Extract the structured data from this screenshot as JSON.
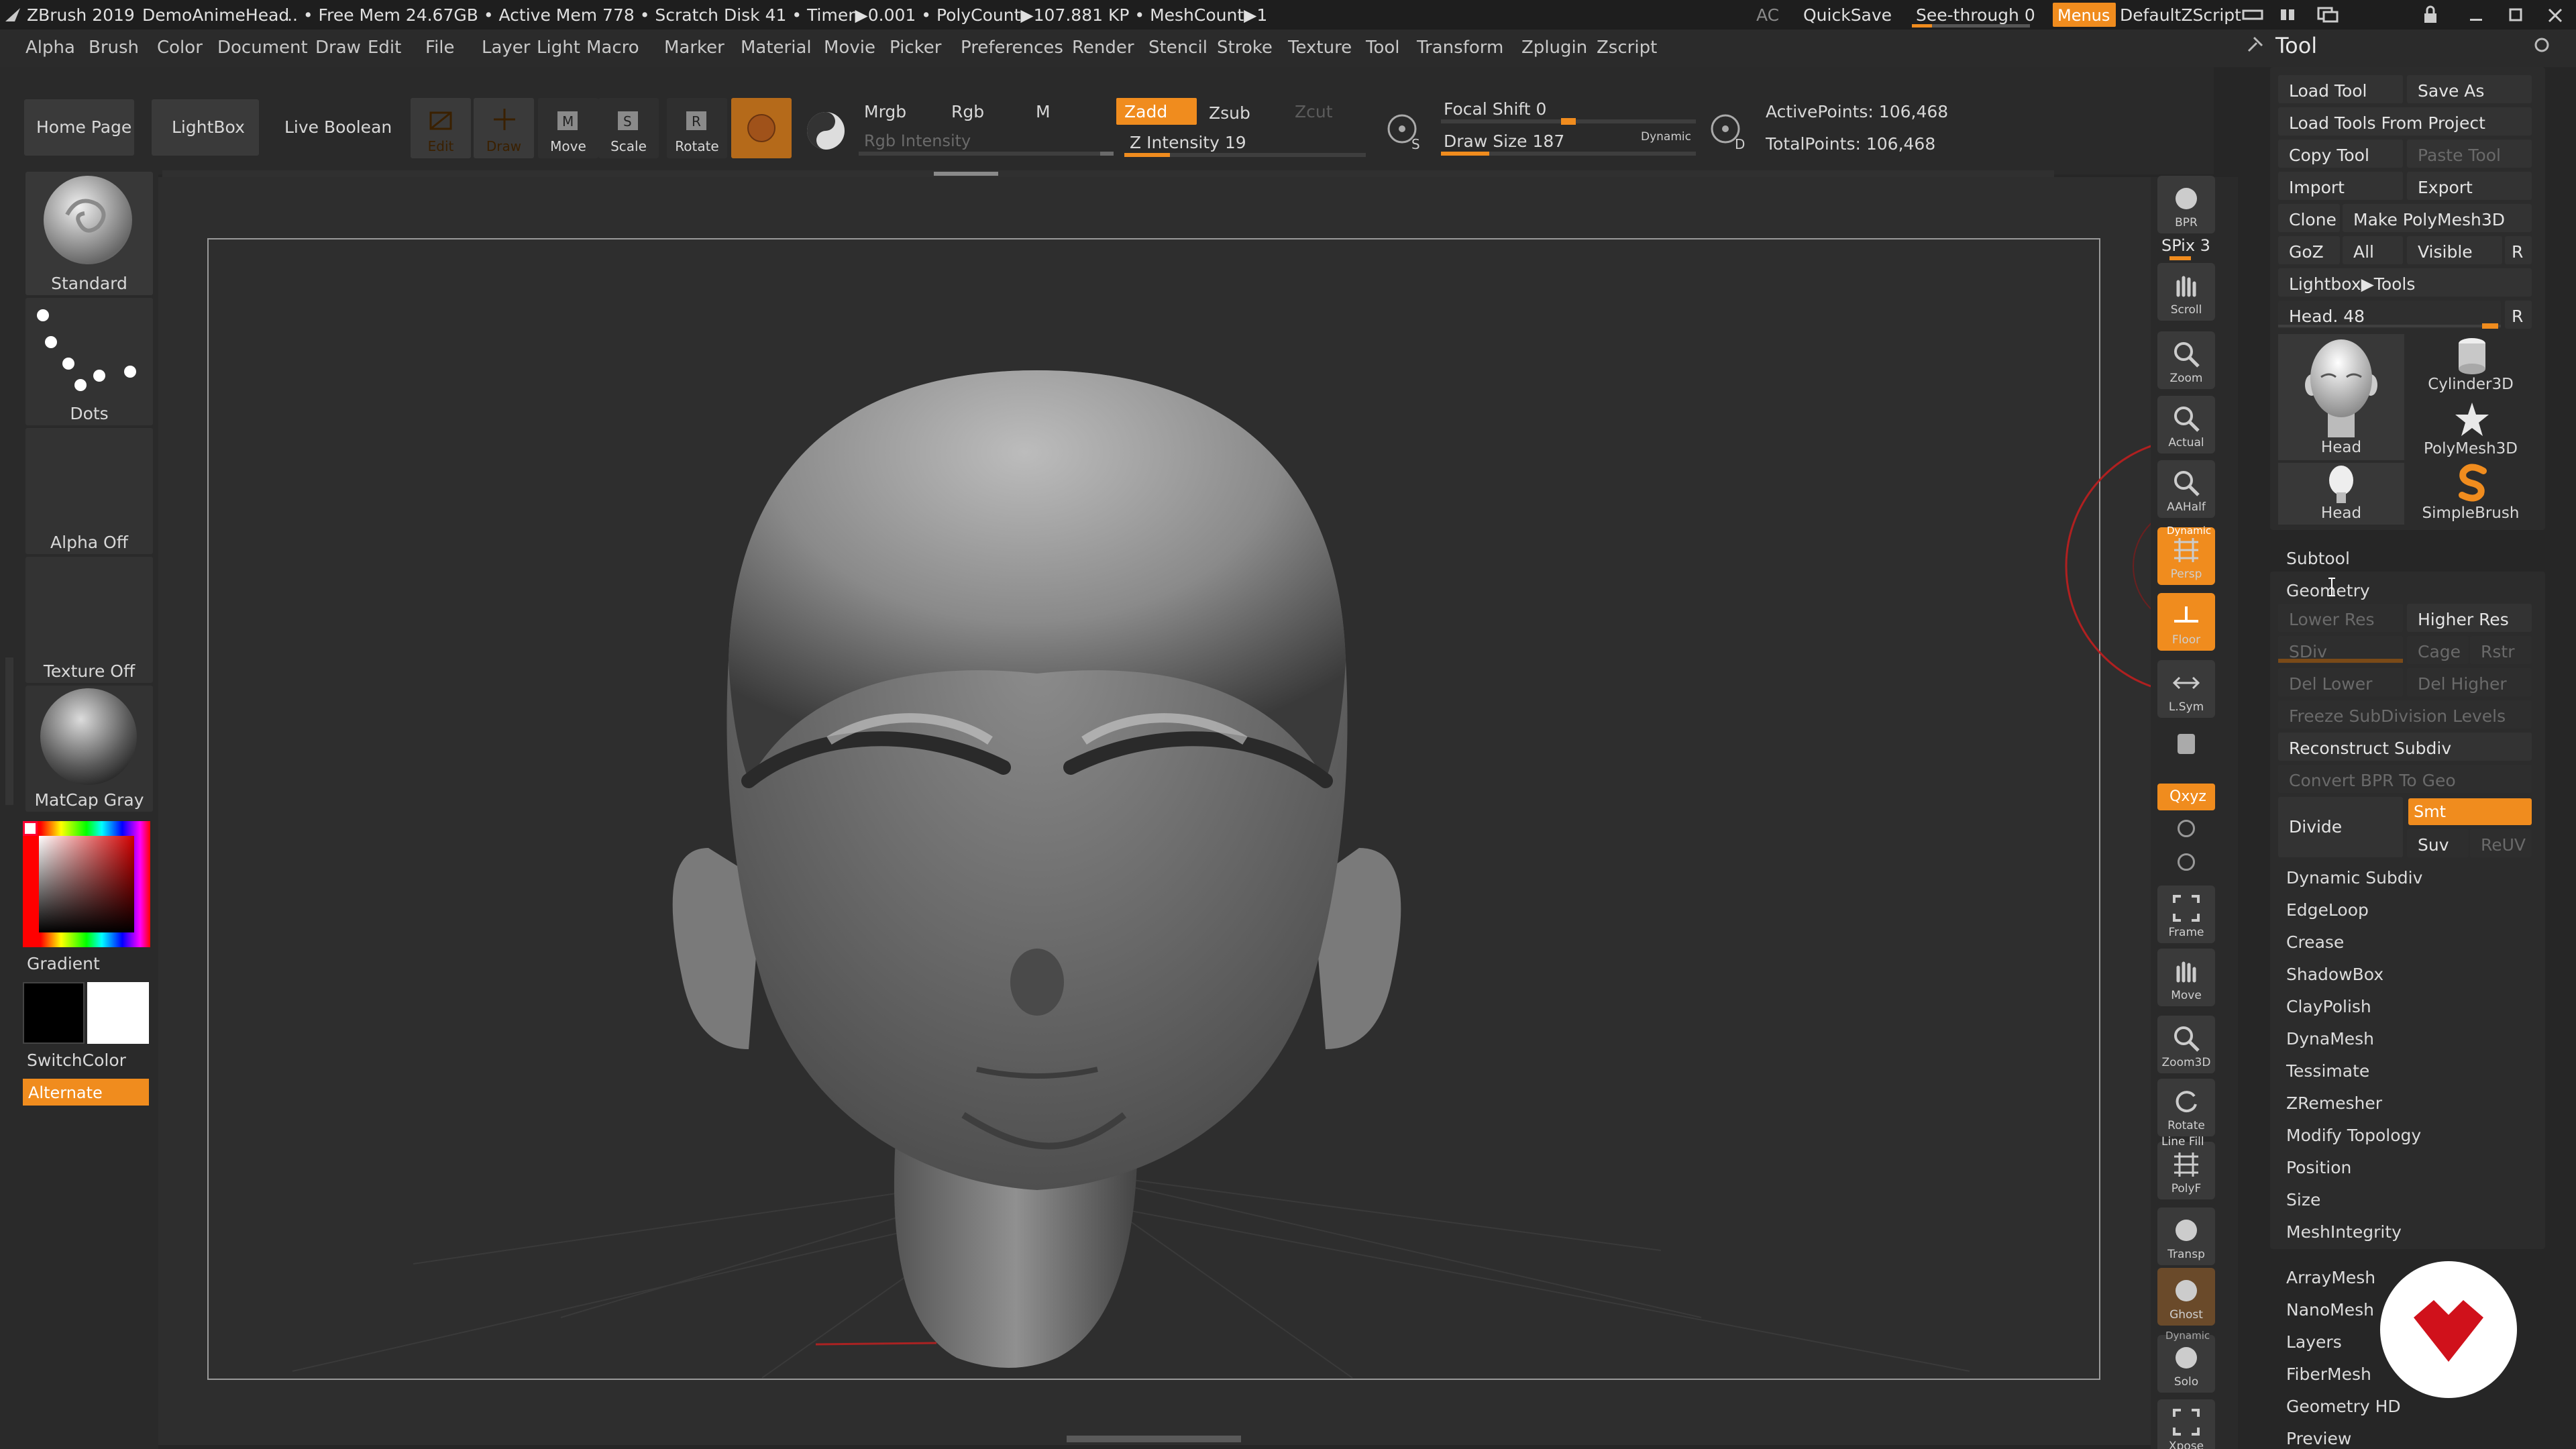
{
  "titlebar": {
    "app": "ZBrush 2019",
    "project": "DemoAnimeHead",
    "status": ".. • Free Mem 24.67GB • Active Mem 778 • Scratch Disk 41 • Timer▶0.001 • PolyCount▶107.881 KP • MeshCount▶1",
    "ac": "AC",
    "quicksave": "QuickSave",
    "seethrough": "See-through  0",
    "menus": "Menus",
    "script": "DefaultZScript"
  },
  "menubar": [
    "Alpha",
    "Brush",
    "Color",
    "Document",
    "Draw",
    "Edit",
    "File",
    "Layer",
    "Light",
    "Macro",
    "Marker",
    "Material",
    "Movie",
    "Picker",
    "Preferences",
    "Render",
    "Stencil",
    "Stroke",
    "Texture",
    "Tool",
    "Transform",
    "Zplugin",
    "Zscript"
  ],
  "toolbar": {
    "home": "Home Page",
    "lightbox": "LightBox",
    "liveboolean": "Live Boolean",
    "edit": "Edit",
    "draw": "Draw",
    "move": "Move",
    "scale": "Scale",
    "rotate": "Rotate",
    "mrgb": "Mrgb",
    "rgb": "Rgb",
    "m": "M",
    "zadd": "Zadd",
    "zsub": "Zsub",
    "zcut": "Zcut",
    "rgb_intensity": "Rgb Intensity",
    "z_intensity": "Z Intensity 19",
    "focal": "Focal Shift 0",
    "drawsize": "Draw Size 187",
    "dynamic": "Dynamic",
    "active_points": "ActivePoints: 106,468",
    "total_points": "TotalPoints: 106,468",
    "z_intensity_level": 0.19,
    "draw_size_level": 0.19,
    "focal_level": 0.5
  },
  "leftpanel": {
    "brush": "Standard",
    "stroke": "Dots",
    "alpha": "Alpha Off",
    "texture": "Texture Off",
    "material": "MatCap Gray",
    "gradient": "Gradient",
    "switchcolor": "SwitchColor",
    "alternate": "Alternate"
  },
  "rightshelf": {
    "bpr": "BPR",
    "spix": "SPix 3",
    "scroll": "Scroll",
    "zoom": "Zoom",
    "actual": "Actual",
    "aahalf": "AAHalf",
    "dynamic": "Dynamic",
    "persp": "Persp",
    "floor": "Floor",
    "lsym": "L.Sym",
    "xyz": "Qxyz",
    "frame": "Frame",
    "move": "Move",
    "zoom3d": "Zoom3D",
    "rotate": "Rotate",
    "linefill": "Line Fill",
    "polyf": "PolyF",
    "transp": "Transp",
    "ghost": "Ghost",
    "dynamic2": "Dynamic",
    "solo": "Solo",
    "xpose": "Xpose"
  },
  "toolpanel": {
    "title": "Tool",
    "load": "Load Tool",
    "saveas": "Save As",
    "loadproject": "Load Tools From Project",
    "copy": "Copy Tool",
    "paste": "Paste Tool",
    "import": "Import",
    "export": "Export",
    "clone": "Clone",
    "makepoly": "Make PolyMesh3D",
    "goz": "GoZ",
    "all": "All",
    "visible": "Visible",
    "r": "R",
    "lightboxtools": "Lightbox▶Tools",
    "head": "Head. 48",
    "thumbs": [
      "Head",
      "Cylinder3D",
      "PolyMesh3D",
      "Head",
      "SimpleBrush"
    ],
    "subtool": "Subtool",
    "geometry": "Geometry",
    "lowerres": "Lower Res",
    "higherres": "Higher Res",
    "sdiv": "SDiv",
    "cage": "Cage",
    "rstr": "Rstr",
    "dellower": "Del Lower",
    "delhigher": "Del Higher",
    "freeze": "Freeze SubDivision Levels",
    "reconstruct": "Reconstruct Subdiv",
    "convertbpr": "Convert BPR To Geo",
    "divide": "Divide",
    "smt": "Smt",
    "suv": "Suv",
    "reuv": "ReUV",
    "geo_items": [
      "Dynamic Subdiv",
      "EdgeLoop",
      "Crease",
      "ShadowBox",
      "ClayPolish",
      "DynaMesh",
      "Tessimate",
      "ZRemesher",
      "Modify Topology",
      "Position",
      "Size",
      "MeshIntegrity"
    ],
    "bottom_items": [
      "ArrayMesh",
      "NanoMesh",
      "Layers",
      "FiberMesh",
      "Geometry HD",
      "Preview"
    ]
  },
  "colors": {
    "accent": "#f08c1e",
    "bg": "#262626",
    "panel": "#333333",
    "badge": "#d0111b"
  }
}
